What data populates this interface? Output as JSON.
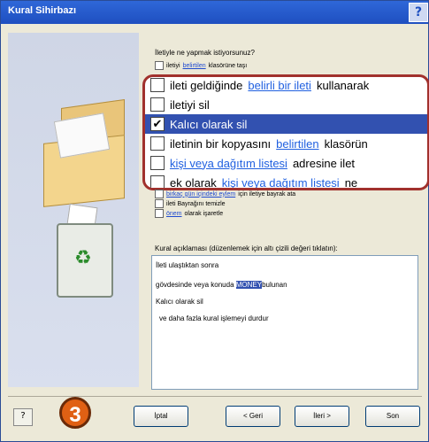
{
  "window": {
    "title": "Kural Sihirbazı",
    "help_label": "?"
  },
  "prompt": "İletiyle ne yapmak istiyorsunuz?",
  "options_small_top": [
    {
      "pre": "iletiyi ",
      "link": "belirtilen",
      "post": " klasörüne taşı"
    }
  ],
  "zoom_options": [
    {
      "pre": "ileti geldiğinde ",
      "link": "belirli bir ileti",
      "post": " kullanarak",
      "checked": false,
      "selected": false
    },
    {
      "pre": "iletiyi sil",
      "link": "",
      "post": "",
      "checked": false,
      "selected": false
    },
    {
      "pre": "Kalıcı olarak sil",
      "link": "",
      "post": "",
      "checked": true,
      "selected": true
    },
    {
      "pre": "iletinin bir kopyasını ",
      "link": "belirtilen",
      "post": " klasörün",
      "checked": false,
      "selected": false
    },
    {
      "pre": "",
      "link": "kişi veya dağıtım listesi",
      "post": " adresine ilet",
      "checked": false,
      "selected": false
    },
    {
      "pre": "ek olarak ",
      "link": "kişi veya dağıtım listesi",
      "post": " ne",
      "checked": false,
      "selected": false
    }
  ],
  "options_small_bottom": [
    {
      "pre": "",
      "link": "birkaç gün içindeki eylem",
      "post": " için iletiye bayrak ata"
    },
    {
      "pre": "ileti Bayrağını temizle",
      "link": "",
      "post": ""
    },
    {
      "pre": "",
      "link": "önem",
      "post": " olarak işaretle"
    }
  ],
  "description": {
    "label": "Kural açıklaması (düzenlemek için altı çizili değeri tıklatın):",
    "lines": [
      "İleti ulaştıktan sonra",
      "gövdesinde veya konuda ",
      "Kalıcı olarak sil",
      "ve daha fazla kural işlemeyi durdur"
    ],
    "highlight": "MONEY",
    "after_highlight": "bulunan"
  },
  "buttons": {
    "cancel": "İptal",
    "back": "< Geri",
    "next": "İleri >",
    "finish": "Son"
  },
  "step_badge": "3"
}
